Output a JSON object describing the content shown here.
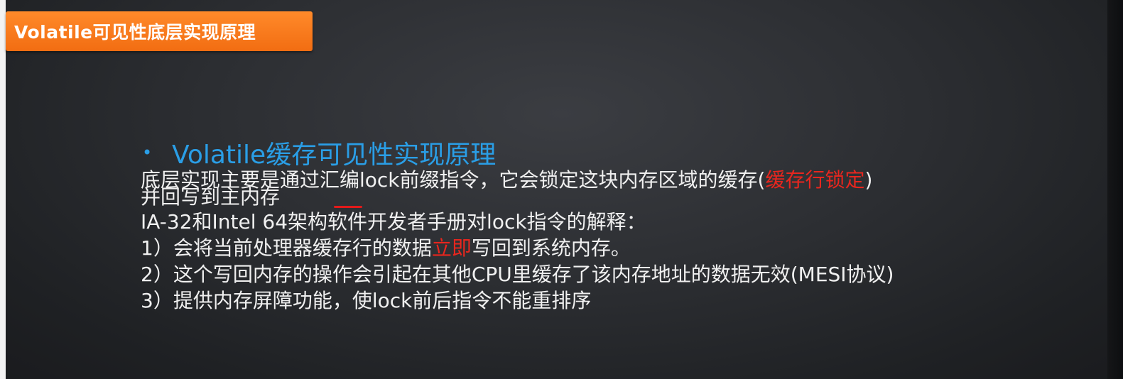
{
  "title": "Volatile可见性底层实现原理",
  "bullet": {
    "symbol": "•",
    "heading": "Volatile缓存可见性实现原理"
  },
  "lines": {
    "line1_part1": "底层实现主要是通过汇编lock前缀指令，它会锁定这块内存区域的缓存(",
    "line1_red": "缓存行锁定",
    "line1_part2": ")",
    "line2": "并回写到主内存",
    "line3": "IA-32和Intel 64架构软件开发者手册对lock指令的解释：",
    "line4_part1": "1）会将当前处理器缓存行的数据",
    "line4_red": "立即",
    "line4_part2": "写回到系统内存。",
    "line5": "2）这个写回内存的操作会引起在其他CPU里缓存了该内存地址的数据无效(MESI协议)",
    "line6": "3）提供内存屏障功能，使lock前后指令不能重排序"
  },
  "colors": {
    "title_bg": "#f26d12",
    "heading": "#2a9ee6",
    "highlight": "#e8261e",
    "body_text": "#f0f0f0",
    "background": "#2c2e32"
  }
}
